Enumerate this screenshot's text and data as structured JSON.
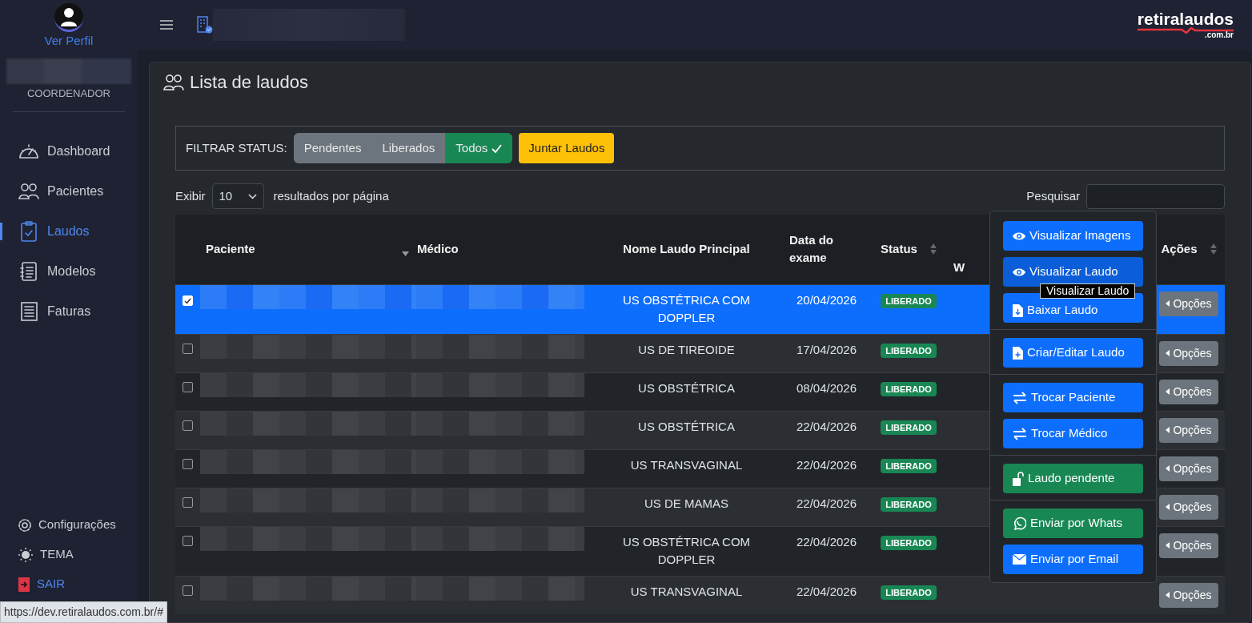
{
  "sidebar": {
    "profile_link": "Ver Perfil",
    "role": "COORDENADOR",
    "items": [
      {
        "label": "Dashboard",
        "selected": false
      },
      {
        "label": "Pacientes",
        "selected": false
      },
      {
        "label": "Laudos",
        "selected": true
      },
      {
        "label": "Modelos",
        "selected": false
      },
      {
        "label": "Faturas",
        "selected": false
      }
    ],
    "bottom_items": [
      {
        "label": "Configurações"
      },
      {
        "label": "TEMA"
      },
      {
        "label": "SAIR"
      }
    ]
  },
  "topbar": {
    "logo": "retiralaudos",
    "logo_suffix": ".com.br"
  },
  "page": {
    "title": "Lista de laudos",
    "filter": {
      "label": "FILTRAR STATUS:",
      "options": [
        {
          "label": "Pendentes",
          "selected": false
        },
        {
          "label": "Liberados",
          "selected": false
        },
        {
          "label": "Todos",
          "selected": true
        }
      ],
      "merge_button": "Juntar Laudos"
    },
    "length": {
      "before": "Exibir",
      "value": "10",
      "after": "resultados por página"
    },
    "search": {
      "label": "Pesquisar"
    }
  },
  "table": {
    "columns": [
      {},
      {
        "label": "Paciente"
      },
      {
        "label": "Médico"
      },
      {
        "label": "Nome Laudo Principal"
      },
      {
        "label": "Data do exame"
      },
      {
        "label": "Status"
      },
      {
        "label": "W"
      },
      {},
      {
        "label": "Ações"
      }
    ],
    "rows": [
      {
        "selected": true,
        "exam": "US OBSTÉTRICA COM DOPPLER",
        "date": "20/04/2026",
        "status": "LIBERADO",
        "action": "Opções"
      },
      {
        "selected": false,
        "exam": "US DE TIREOIDE",
        "date": "17/04/2026",
        "status": "LIBERADO",
        "action": "Opções"
      },
      {
        "selected": false,
        "exam": "US OBSTÉTRICA",
        "date": "08/04/2026",
        "status": "LIBERADO",
        "action": "Opções"
      },
      {
        "selected": false,
        "exam": "US OBSTÉTRICA",
        "date": "22/04/2026",
        "status": "LIBERADO",
        "action": "Opções"
      },
      {
        "selected": false,
        "exam": "US TRANSVAGINAL",
        "date": "22/04/2026",
        "status": "LIBERADO",
        "action": "Opções"
      },
      {
        "selected": false,
        "exam": "US DE MAMAS",
        "date": "22/04/2026",
        "status": "LIBERADO",
        "action": "Opções"
      },
      {
        "selected": false,
        "exam": "US OBSTÉTRICA COM DOPPLER",
        "date": "22/04/2026",
        "status": "LIBERADO",
        "action": "Opções"
      },
      {
        "selected": false,
        "exam": "US TRANSVAGINAL",
        "date": "22/04/2026",
        "status": "LIBERADO",
        "action": "Opções"
      }
    ]
  },
  "actions_menu": {
    "groups": [
      [
        {
          "label": "Visualizar Imagens",
          "hovered": false
        },
        {
          "label": "Visualizar Laudo",
          "hovered": true
        },
        {
          "label": "Baixar Laudo",
          "hovered": false
        }
      ],
      [
        {
          "label": "Criar/Editar Laudo",
          "hovered": false
        }
      ],
      [
        {
          "label": "Trocar Paciente",
          "hovered": false
        },
        {
          "label": "Trocar Médico",
          "hovered": false
        }
      ],
      [
        {
          "label": "Laudo pendente",
          "hovered": false
        }
      ],
      [
        {
          "label": "Enviar por Whats",
          "hovered": false
        },
        {
          "label": "Enviar por Email",
          "hovered": false
        }
      ]
    ]
  },
  "tooltip": "Visualizar Laudo",
  "status_url": "https://dev.retiralaudos.com.br/#"
}
